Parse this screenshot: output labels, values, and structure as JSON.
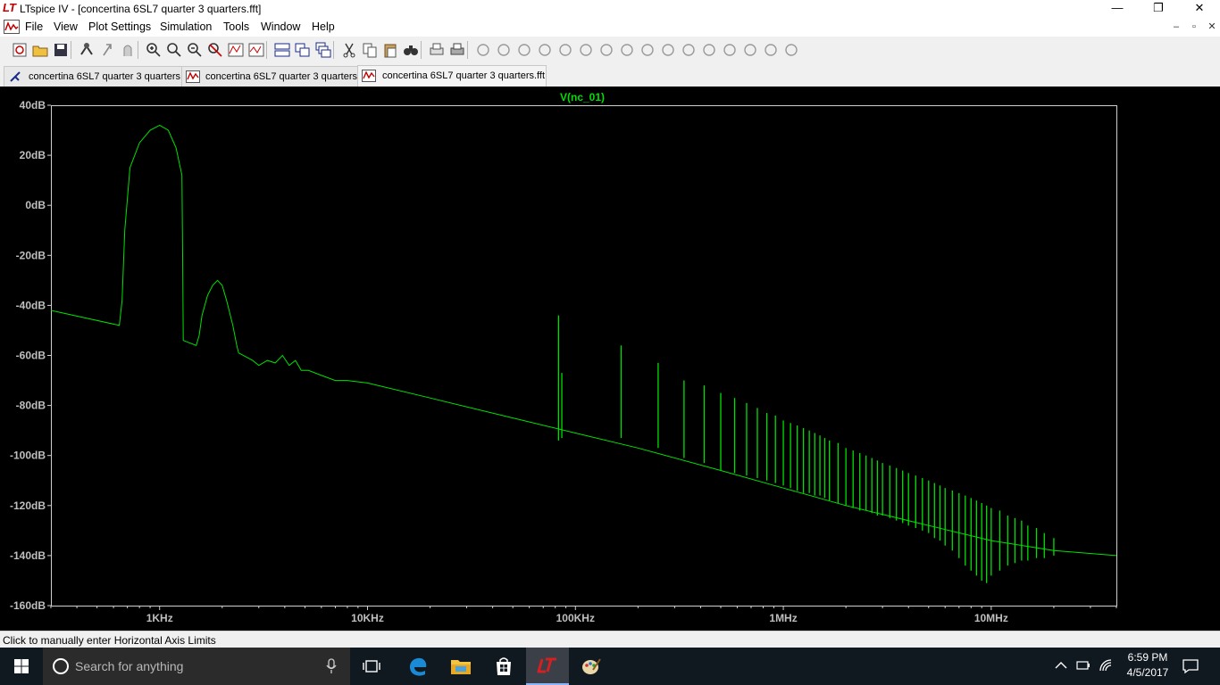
{
  "window": {
    "title": "LTspice IV - [concertina 6SL7 quarter 3 quarters.fft]",
    "logo_text": "LT",
    "controls": [
      "—",
      "❐",
      "✕"
    ],
    "mdi_controls": [
      "–",
      "▫",
      "✕"
    ]
  },
  "menu": {
    "items": [
      "File",
      "View",
      "Plot Settings",
      "Simulation",
      "Tools",
      "Window",
      "Help"
    ]
  },
  "toolbar": {
    "icons": [
      "new-schematic-icon",
      "open-icon",
      "save-icon",
      "control-panel-icon",
      "run-icon",
      "halt-icon",
      "zoom-in-icon",
      "zoom-area-icon",
      "zoom-out-icon",
      "zoom-fit-icon",
      "autorange-icon",
      "plot-settings-icon",
      "tile-horizontal-icon",
      "tile-vertical-icon",
      "cascade-icon",
      "cut-icon",
      "copy-icon",
      "paste-icon",
      "find-icon",
      "print-preview-icon",
      "print-icon",
      "wire-icon",
      "ground-icon",
      "label-icon",
      "resistor-icon",
      "capacitor-icon",
      "inductor-icon",
      "diode-icon",
      "component-icon",
      "move-icon",
      "drag-icon",
      "undo-icon",
      "redo-icon",
      "rotate-icon",
      "mirror-icon",
      "text-icon",
      "spice-directive-icon"
    ]
  },
  "tabs": [
    {
      "label": "concertina 6SL7 quarter 3 quarters",
      "icon": "schematic-icon",
      "active": false
    },
    {
      "label": "concertina 6SL7 quarter 3 quarters",
      "icon": "waveform-icon",
      "active": false
    },
    {
      "label": "concertina 6SL7 quarter 3 quarters.fft",
      "icon": "waveform-icon",
      "active": true
    }
  ],
  "status": {
    "text": "Click to manually enter Horizontal Axis Limits"
  },
  "taskbar": {
    "search_placeholder": "Search for anything",
    "time": "6:59 PM",
    "date": "4/5/2017"
  },
  "colors": {
    "trace": "#00e000",
    "plot_background": "#000000",
    "axis_frame": "#d0d0d0",
    "tick_text": "#bfbfbf"
  },
  "chart_data": {
    "type": "line",
    "title": "V(nc_01)",
    "xscale": "log",
    "xlim": [
      300,
      40000000
    ],
    "ylim": [
      -160,
      40
    ],
    "x_ticks": [
      "1KHz",
      "10KHz",
      "100KHz",
      "1MHz",
      "10MHz"
    ],
    "y_ticks": [
      "40dB",
      "20dB",
      "0dB",
      "-20dB",
      "-40dB",
      "-60dB",
      "-80dB",
      "-100dB",
      "-120dB",
      "-140dB",
      "-160dB"
    ],
    "series": [
      {
        "name": "V(nc_01)",
        "baseline": {
          "x": [
            300,
            640,
            660,
            680,
            720,
            800,
            900,
            1000,
            1100,
            1200,
            1280,
            1290,
            1300,
            1500,
            1550,
            1600,
            1700,
            1800,
            1900,
            2000,
            2100,
            2250,
            2350,
            2400,
            2800,
            3000,
            3300,
            3600,
            3900,
            4200,
            4500,
            4800,
            5200,
            6000,
            7000,
            8000,
            10000,
            20000,
            50000,
            100000,
            200000,
            500000,
            1000000,
            2000000,
            5000000,
            10000000,
            20000000,
            40000000
          ],
          "y": [
            -42,
            -48,
            -38,
            -10,
            15,
            25,
            30,
            32,
            30,
            23,
            12,
            -20,
            -54,
            -56,
            -52,
            -44,
            -36,
            -32,
            -30,
            -32,
            -38,
            -48,
            -56,
            -59,
            -62,
            -64,
            -62,
            -63,
            -60,
            -64,
            -62,
            -66,
            -66,
            -68,
            -70,
            -70,
            -71,
            -77,
            -85,
            -91,
            -97,
            -106,
            -113,
            -120,
            -128,
            -134,
            -138,
            -140
          ]
        },
        "spikes": [
          {
            "x": 83000,
            "peak": -44,
            "trough": -94
          },
          {
            "x": 86000,
            "peak": -67,
            "trough": -93
          },
          {
            "x": 166000,
            "peak": -56,
            "trough": -93
          },
          {
            "x": 250000,
            "peak": -63,
            "trough": -97
          },
          {
            "x": 333000,
            "peak": -70,
            "trough": -101
          },
          {
            "x": 416000,
            "peak": -72,
            "trough": -103
          },
          {
            "x": 500000,
            "peak": -75,
            "trough": -106
          },
          {
            "x": 583000,
            "peak": -77,
            "trough": -107
          },
          {
            "x": 666000,
            "peak": -79,
            "trough": -108
          },
          {
            "x": 750000,
            "peak": -81,
            "trough": -109
          },
          {
            "x": 833000,
            "peak": -83,
            "trough": -110
          },
          {
            "x": 916000,
            "peak": -84,
            "trough": -111
          },
          {
            "x": 1000000,
            "peak": -86,
            "trough": -112
          },
          {
            "x": 1083000,
            "peak": -87,
            "trough": -113
          },
          {
            "x": 1166000,
            "peak": -88,
            "trough": -114
          },
          {
            "x": 1250000,
            "peak": -89,
            "trough": -115
          },
          {
            "x": 1333000,
            "peak": -90,
            "trough": -115
          },
          {
            "x": 1416000,
            "peak": -91,
            "trough": -116
          },
          {
            "x": 1500000,
            "peak": -92,
            "trough": -116
          },
          {
            "x": 1583000,
            "peak": -93,
            "trough": -117
          },
          {
            "x": 1666000,
            "peak": -94,
            "trough": -118
          },
          {
            "x": 1833000,
            "peak": -95,
            "trough": -119
          },
          {
            "x": 2000000,
            "peak": -97,
            "trough": -120
          },
          {
            "x": 2166000,
            "peak": -98,
            "trough": -121
          },
          {
            "x": 2333000,
            "peak": -99,
            "trough": -122
          },
          {
            "x": 2500000,
            "peak": -100,
            "trough": -122
          },
          {
            "x": 2666000,
            "peak": -101,
            "trough": -123
          },
          {
            "x": 2833000,
            "peak": -102,
            "trough": -124
          },
          {
            "x": 3000000,
            "peak": -103,
            "trough": -124
          },
          {
            "x": 3250000,
            "peak": -104,
            "trough": -125
          },
          {
            "x": 3500000,
            "peak": -105,
            "trough": -126
          },
          {
            "x": 3750000,
            "peak": -106,
            "trough": -127
          },
          {
            "x": 4000000,
            "peak": -107,
            "trough": -128
          },
          {
            "x": 4333000,
            "peak": -108,
            "trough": -129
          },
          {
            "x": 4666000,
            "peak": -109,
            "trough": -130
          },
          {
            "x": 5000000,
            "peak": -110,
            "trough": -131
          },
          {
            "x": 5333000,
            "peak": -111,
            "trough": -133
          },
          {
            "x": 5666000,
            "peak": -112,
            "trough": -134
          },
          {
            "x": 6000000,
            "peak": -113,
            "trough": -136
          },
          {
            "x": 6500000,
            "peak": -114,
            "trough": -138
          },
          {
            "x": 7000000,
            "peak": -115,
            "trough": -141
          },
          {
            "x": 7500000,
            "peak": -116,
            "trough": -144
          },
          {
            "x": 8000000,
            "peak": -117,
            "trough": -146
          },
          {
            "x": 8500000,
            "peak": -118,
            "trough": -148
          },
          {
            "x": 9000000,
            "peak": -119,
            "trough": -150
          },
          {
            "x": 9500000,
            "peak": -120,
            "trough": -151
          },
          {
            "x": 10000000,
            "peak": -121,
            "trough": -148
          },
          {
            "x": 11000000,
            "peak": -122,
            "trough": -146
          },
          {
            "x": 12000000,
            "peak": -124,
            "trough": -144
          },
          {
            "x": 13000000,
            "peak": -125,
            "trough": -143
          },
          {
            "x": 14000000,
            "peak": -126,
            "trough": -142
          },
          {
            "x": 15000000,
            "peak": -128,
            "trough": -142
          },
          {
            "x": 16500000,
            "peak": -129,
            "trough": -141
          },
          {
            "x": 18000000,
            "peak": -131,
            "trough": -141
          },
          {
            "x": 20000000,
            "peak": -133,
            "trough": -140
          }
        ]
      }
    ],
    "grid": false,
    "legend": "title-top-center"
  }
}
